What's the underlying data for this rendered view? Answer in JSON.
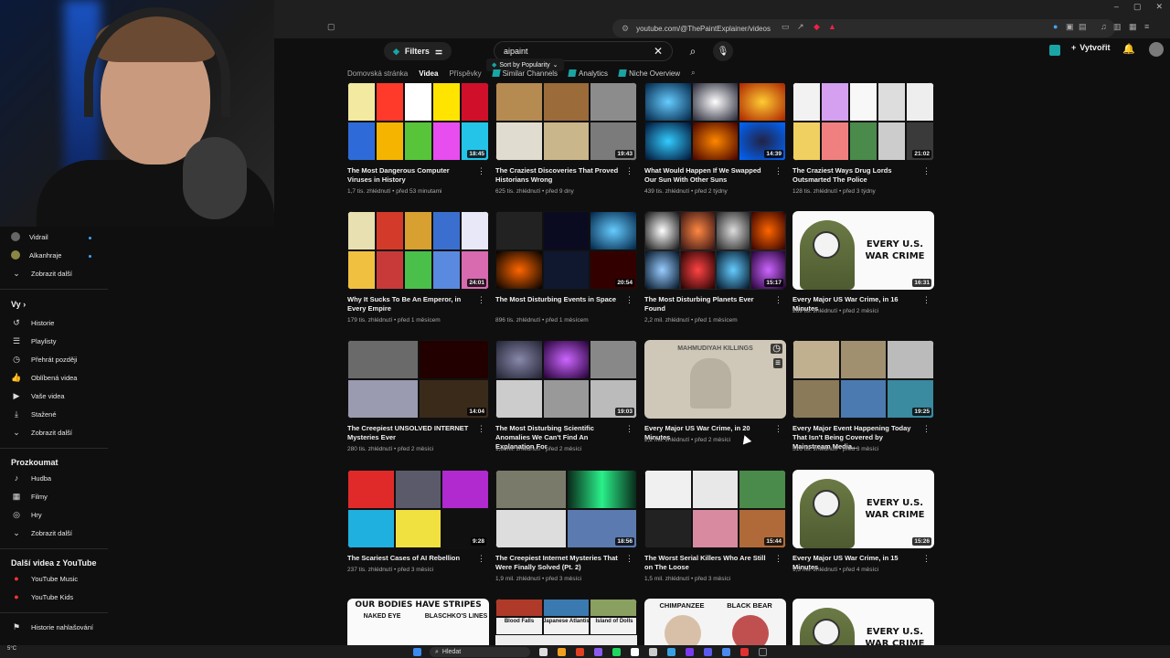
{
  "browser": {
    "url": "youtube.com/@ThePaintExplainer/videos"
  },
  "header": {
    "filters_label": "Filters",
    "search_value": "aipaint",
    "sort_label": "Sort by Popularity",
    "create_label": "Vytvořit"
  },
  "tabs": {
    "home": "Domovská stránka",
    "videos": "Videa",
    "posts": "Příspěvky",
    "similar": "Similar Channels",
    "analytics": "Analytics",
    "niche": "Niche Overview"
  },
  "sidebar": {
    "subs": [
      {
        "label": "Vidrail"
      },
      {
        "label": "Alkanhraje"
      }
    ],
    "show_more_1": "Zobrazit další",
    "you_heading": "Vy",
    "you_items": [
      "Historie",
      "Playlisty",
      "Přehrát později",
      "Oblíbená videa",
      "Vaše videa",
      "Stažené",
      "Zobrazit další"
    ],
    "explore_heading": "Prozkoumat",
    "explore_items": [
      "Hudba",
      "Filmy",
      "Hry",
      "Zobrazit další"
    ],
    "more_heading": "Další videa z YouTube",
    "more_items": [
      "YouTube Music",
      "YouTube Kids"
    ],
    "report_history": "Historie nahlašování"
  },
  "videos": [
    {
      "title": "The Most Dangerous Computer Viruses in History",
      "meta": "1,7 tis. zhlédnutí • před 53 minutami",
      "duration": "18:45"
    },
    {
      "title": "The Craziest Discoveries That Proved Historians Wrong",
      "meta": "625 tis. zhlédnutí • před 9 dny",
      "duration": "19:43"
    },
    {
      "title": "What Would Happen If We Swapped Our Sun With Other Suns",
      "meta": "439 tis. zhlédnutí • před 2 týdny",
      "duration": "14:39"
    },
    {
      "title": "The Craziest Ways Drug Lords Outsmarted The Police",
      "meta": "128 tis. zhlédnutí • před 3 týdny",
      "duration": "21:02"
    },
    {
      "title": "Why It Sucks To Be An Emperor, in Every Empire",
      "meta": "179 tis. zhlédnutí • před 1 měsícem",
      "duration": "24:01"
    },
    {
      "title": "The Most Disturbing Events in Space",
      "meta": "896 tis. zhlédnutí • před 1 měsícem",
      "duration": "20:54"
    },
    {
      "title": "The Most Disturbing Planets Ever Found",
      "meta": "2,2 mil. zhlédnutí • před 1 měsícem",
      "duration": "15:17"
    },
    {
      "title": "Every Major US War Crime, in 16 Minutes",
      "meta": "269 tis. zhlédnutí • před 2 měsíci",
      "duration": "16:31",
      "thumb_text": "EVERY U.S. WAR CRIME"
    },
    {
      "title": "The Creepiest UNSOLVED INTERNET Mysteries Ever",
      "meta": "280 tis. zhlédnutí • před 2 měsíci",
      "duration": "14:04"
    },
    {
      "title": "The Most Disturbing Scientific Anomalies We Can't Find An Explanation For",
      "meta": "1,8 mil. zhlédnutí • před 2 měsíci",
      "duration": "19:03"
    },
    {
      "title": "Every Major US War Crime, in 20 Minutes",
      "meta": "2,2 mil. zhlédnutí • před 2 měsíci",
      "duration": "",
      "thumb_text": "MAHMUDIYAH KILLINGS"
    },
    {
      "title": "Every Major Event Happening Today That Isn't Being Covered by Mainstream Media...",
      "meta": "516 tis. zhlédnutí • před 3 měsíci",
      "duration": "19:25"
    },
    {
      "title": "The Scariest Cases of AI Rebellion",
      "meta": "237 tis. zhlédnutí • před 3 měsíci",
      "duration": "9:28"
    },
    {
      "title": "The Creepiest Internet Mysteries That Were Finally Solved (Pt. 2)",
      "meta": "1,9 mil. zhlédnutí • před 3 měsíci",
      "duration": "18:56"
    },
    {
      "title": "The Worst Serial Killers Who Are Still on The Loose",
      "meta": "1,5 mil. zhlédnutí • před 3 měsíci",
      "duration": "15:44"
    },
    {
      "title": "Every Major US War Crime, in 15 Minutes",
      "meta": "1,3 mil. zhlédnutí • před 4 měsíci",
      "duration": "15:26",
      "thumb_text": "EVERY U.S. WAR CRIME"
    },
    {
      "title": "",
      "meta": "",
      "duration": "",
      "thumb_text": "OUR BODIES HAVE STRIPES",
      "thumb_sub": [
        "NAKED EYE",
        "BLASCHKO'S LINES"
      ]
    },
    {
      "title": "",
      "meta": "",
      "duration": "",
      "thumb_sub": [
        "Blood Falls",
        "Japanese Atlantis",
        "Island of Dolls"
      ]
    },
    {
      "title": "",
      "meta": "",
      "duration": "",
      "thumb_sub": [
        "CHIMPANZEE",
        "BLACK BEAR"
      ]
    },
    {
      "title": "",
      "meta": "",
      "duration": "",
      "thumb_text": "EVERY U.S. WAR CRIME"
    }
  ],
  "taskbar": {
    "search_label": "Hledat",
    "weather": "5°C"
  },
  "colors": {
    "background": "#0f0f0f",
    "accent_ext": "#1aa4a4",
    "link_dot": "#3ea6ff"
  }
}
